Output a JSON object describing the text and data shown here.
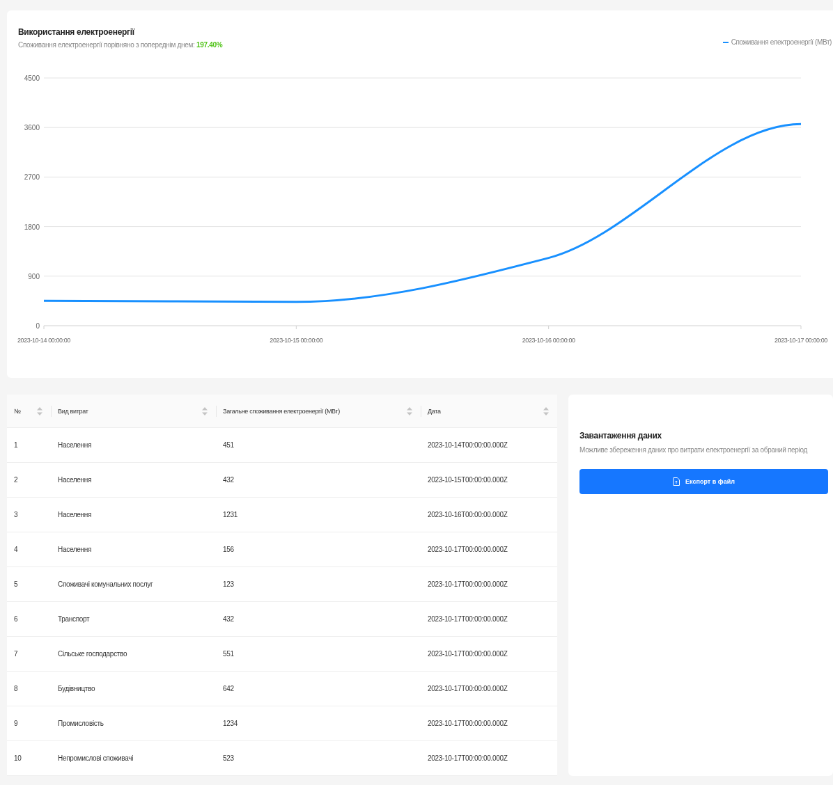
{
  "chart_card": {
    "title": "Використання електроенергії",
    "subtitle": "Споживання електроенергії порівняно з попереднім днем: **197.40%**",
    "chart_data": {
      "type": "line",
      "x": [
        "2023-10-14 00:00:00",
        "2023-10-15 00:00:00",
        "2023-10-16 00:00:00",
        "2023-10-17 00:00:00"
      ],
      "series": [
        {
          "name": "Споживання електроенергії (МВт)",
          "color": "#1890ff",
          "values": [
            451,
            432,
            1231,
            3661
          ]
        }
      ],
      "ylim": [
        0,
        4500
      ],
      "grid": true,
      "yticks": [
        0,
        900,
        1800,
        2700,
        3600,
        4500
      ]
    }
  },
  "table": {
    "columns": [
      "№",
      "Вид витрат",
      "Загальне споживання електроенергії (МВт)",
      "Дата"
    ],
    "rows": [
      [
        "1",
        "Населення",
        "451",
        "2023-10-14T00:00:00.000Z"
      ],
      [
        "2",
        "Населення",
        "432",
        "2023-10-15T00:00:00.000Z"
      ],
      [
        "3",
        "Населення",
        "1231",
        "2023-10-16T00:00:00.000Z"
      ],
      [
        "4",
        "Населення",
        "156",
        "2023-10-17T00:00:00.000Z"
      ],
      [
        "5",
        "Споживачі комунальних послуг",
        "123",
        "2023-10-17T00:00:00.000Z"
      ],
      [
        "6",
        "Транспорт",
        "432",
        "2023-10-17T00:00:00.000Z"
      ],
      [
        "7",
        "Сільське господарство",
        "551",
        "2023-10-17T00:00:00.000Z"
      ],
      [
        "8",
        "Будівництво",
        "642",
        "2023-10-17T00:00:00.000Z"
      ],
      [
        "9",
        "Промисловість",
        "1234",
        "2023-10-17T00:00:00.000Z"
      ],
      [
        "10",
        "Непромислові споживачі",
        "523",
        "2023-10-17T00:00:00.000Z"
      ]
    ]
  },
  "export_card": {
    "title": "Завантаження даних",
    "description": "Можливе збереження даних про витрати електроенергії за обраний період",
    "button": "Експорт в файл"
  }
}
